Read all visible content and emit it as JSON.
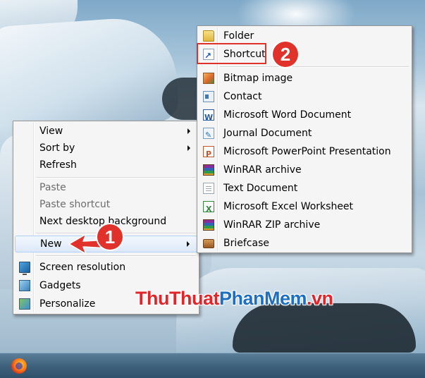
{
  "context_menu": {
    "items": [
      {
        "label": "View",
        "submenu": true
      },
      {
        "label": "Sort by",
        "submenu": true
      },
      {
        "label": "Refresh"
      },
      {
        "label": "Paste",
        "disabled": true
      },
      {
        "label": "Paste shortcut",
        "disabled": true
      },
      {
        "label": "Next desktop background"
      },
      {
        "label": "New",
        "submenu": true,
        "highlighted": true
      },
      {
        "label": "Screen resolution",
        "icon": "screen-resolution-icon"
      },
      {
        "label": "Gadgets",
        "icon": "gadgets-icon"
      },
      {
        "label": "Personalize",
        "icon": "personalize-icon"
      }
    ]
  },
  "new_submenu": {
    "items": [
      {
        "label": "Folder",
        "icon": "folder-icon"
      },
      {
        "label": "Shortcut",
        "icon": "shortcut-icon",
        "annotated": true
      },
      {
        "label": "Bitmap image",
        "icon": "bitmap-image-icon"
      },
      {
        "label": "Contact",
        "icon": "contact-icon"
      },
      {
        "label": "Microsoft Word Document",
        "icon": "word-document-icon"
      },
      {
        "label": "Journal Document",
        "icon": "journal-document-icon"
      },
      {
        "label": "Microsoft PowerPoint Presentation",
        "icon": "powerpoint-icon"
      },
      {
        "label": "WinRAR archive",
        "icon": "winrar-icon"
      },
      {
        "label": "Text Document",
        "icon": "text-document-icon"
      },
      {
        "label": "Microsoft Excel Worksheet",
        "icon": "excel-icon"
      },
      {
        "label": "WinRAR ZIP archive",
        "icon": "winrar-zip-icon"
      },
      {
        "label": "Briefcase",
        "icon": "briefcase-icon"
      }
    ]
  },
  "annotations": {
    "step1": "1",
    "step2": "2",
    "accent_color": "#e0312b"
  },
  "watermark": {
    "part1": "ThuThuat",
    "part2": "PhanMem",
    "part3": ".vn"
  },
  "taskbar": {
    "pinned_icon": "firefox-icon"
  }
}
